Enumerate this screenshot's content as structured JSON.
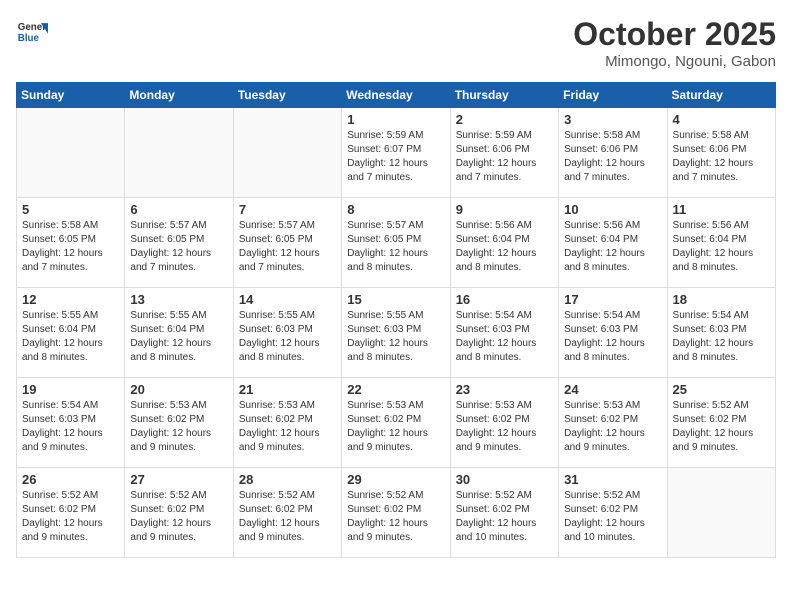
{
  "logo": {
    "line1": "General",
    "line2": "Blue"
  },
  "title": "October 2025",
  "location": "Mimongo, Ngouni, Gabon",
  "weekdays": [
    "Sunday",
    "Monday",
    "Tuesday",
    "Wednesday",
    "Thursday",
    "Friday",
    "Saturday"
  ],
  "weeks": [
    [
      {
        "day": "",
        "info": ""
      },
      {
        "day": "",
        "info": ""
      },
      {
        "day": "",
        "info": ""
      },
      {
        "day": "1",
        "info": "Sunrise: 5:59 AM\nSunset: 6:07 PM\nDaylight: 12 hours\nand 7 minutes."
      },
      {
        "day": "2",
        "info": "Sunrise: 5:59 AM\nSunset: 6:06 PM\nDaylight: 12 hours\nand 7 minutes."
      },
      {
        "day": "3",
        "info": "Sunrise: 5:58 AM\nSunset: 6:06 PM\nDaylight: 12 hours\nand 7 minutes."
      },
      {
        "day": "4",
        "info": "Sunrise: 5:58 AM\nSunset: 6:06 PM\nDaylight: 12 hours\nand 7 minutes."
      }
    ],
    [
      {
        "day": "5",
        "info": "Sunrise: 5:58 AM\nSunset: 6:05 PM\nDaylight: 12 hours\nand 7 minutes."
      },
      {
        "day": "6",
        "info": "Sunrise: 5:57 AM\nSunset: 6:05 PM\nDaylight: 12 hours\nand 7 minutes."
      },
      {
        "day": "7",
        "info": "Sunrise: 5:57 AM\nSunset: 6:05 PM\nDaylight: 12 hours\nand 7 minutes."
      },
      {
        "day": "8",
        "info": "Sunrise: 5:57 AM\nSunset: 6:05 PM\nDaylight: 12 hours\nand 8 minutes."
      },
      {
        "day": "9",
        "info": "Sunrise: 5:56 AM\nSunset: 6:04 PM\nDaylight: 12 hours\nand 8 minutes."
      },
      {
        "day": "10",
        "info": "Sunrise: 5:56 AM\nSunset: 6:04 PM\nDaylight: 12 hours\nand 8 minutes."
      },
      {
        "day": "11",
        "info": "Sunrise: 5:56 AM\nSunset: 6:04 PM\nDaylight: 12 hours\nand 8 minutes."
      }
    ],
    [
      {
        "day": "12",
        "info": "Sunrise: 5:55 AM\nSunset: 6:04 PM\nDaylight: 12 hours\nand 8 minutes."
      },
      {
        "day": "13",
        "info": "Sunrise: 5:55 AM\nSunset: 6:04 PM\nDaylight: 12 hours\nand 8 minutes."
      },
      {
        "day": "14",
        "info": "Sunrise: 5:55 AM\nSunset: 6:03 PM\nDaylight: 12 hours\nand 8 minutes."
      },
      {
        "day": "15",
        "info": "Sunrise: 5:55 AM\nSunset: 6:03 PM\nDaylight: 12 hours\nand 8 minutes."
      },
      {
        "day": "16",
        "info": "Sunrise: 5:54 AM\nSunset: 6:03 PM\nDaylight: 12 hours\nand 8 minutes."
      },
      {
        "day": "17",
        "info": "Sunrise: 5:54 AM\nSunset: 6:03 PM\nDaylight: 12 hours\nand 8 minutes."
      },
      {
        "day": "18",
        "info": "Sunrise: 5:54 AM\nSunset: 6:03 PM\nDaylight: 12 hours\nand 8 minutes."
      }
    ],
    [
      {
        "day": "19",
        "info": "Sunrise: 5:54 AM\nSunset: 6:03 PM\nDaylight: 12 hours\nand 9 minutes."
      },
      {
        "day": "20",
        "info": "Sunrise: 5:53 AM\nSunset: 6:02 PM\nDaylight: 12 hours\nand 9 minutes."
      },
      {
        "day": "21",
        "info": "Sunrise: 5:53 AM\nSunset: 6:02 PM\nDaylight: 12 hours\nand 9 minutes."
      },
      {
        "day": "22",
        "info": "Sunrise: 5:53 AM\nSunset: 6:02 PM\nDaylight: 12 hours\nand 9 minutes."
      },
      {
        "day": "23",
        "info": "Sunrise: 5:53 AM\nSunset: 6:02 PM\nDaylight: 12 hours\nand 9 minutes."
      },
      {
        "day": "24",
        "info": "Sunrise: 5:53 AM\nSunset: 6:02 PM\nDaylight: 12 hours\nand 9 minutes."
      },
      {
        "day": "25",
        "info": "Sunrise: 5:52 AM\nSunset: 6:02 PM\nDaylight: 12 hours\nand 9 minutes."
      }
    ],
    [
      {
        "day": "26",
        "info": "Sunrise: 5:52 AM\nSunset: 6:02 PM\nDaylight: 12 hours\nand 9 minutes."
      },
      {
        "day": "27",
        "info": "Sunrise: 5:52 AM\nSunset: 6:02 PM\nDaylight: 12 hours\nand 9 minutes."
      },
      {
        "day": "28",
        "info": "Sunrise: 5:52 AM\nSunset: 6:02 PM\nDaylight: 12 hours\nand 9 minutes."
      },
      {
        "day": "29",
        "info": "Sunrise: 5:52 AM\nSunset: 6:02 PM\nDaylight: 12 hours\nand 9 minutes."
      },
      {
        "day": "30",
        "info": "Sunrise: 5:52 AM\nSunset: 6:02 PM\nDaylight: 12 hours\nand 10 minutes."
      },
      {
        "day": "31",
        "info": "Sunrise: 5:52 AM\nSunset: 6:02 PM\nDaylight: 12 hours\nand 10 minutes."
      },
      {
        "day": "",
        "info": ""
      }
    ]
  ]
}
